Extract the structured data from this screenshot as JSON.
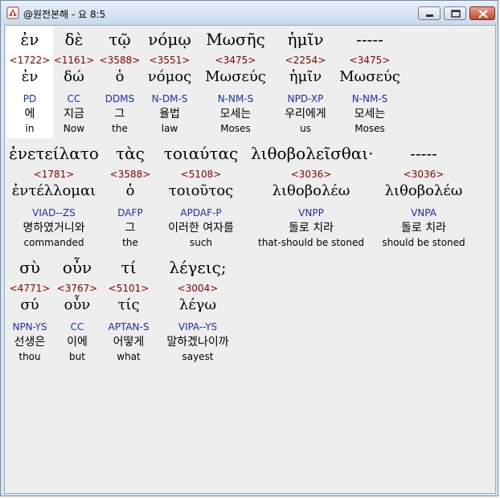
{
  "window": {
    "title": "@원전본해 - 요 8:5",
    "icon": "bible-app-icon",
    "controls": [
      "minimize-icon",
      "maximize-icon",
      "close-icon"
    ],
    "colors": {
      "strong": "#8b0000",
      "parsing": "#1f2fb5",
      "text": "#000000",
      "background": "#eeeeee",
      "highlight": "#ffffff"
    }
  },
  "rows": [
    {
      "words": [
        {
          "greek": "ἐν",
          "strong": "<1722>",
          "lemma": "ἐν",
          "parsing": "PD",
          "korean": "에",
          "english": "in"
        },
        {
          "greek": "δὲ",
          "strong": "<1161>",
          "lemma": "δώ",
          "parsing": "CC",
          "korean": "지금",
          "english": "Now"
        },
        {
          "greek": "τῷ",
          "strong": "<3588>",
          "lemma": "ὁ",
          "parsing": "DDMS",
          "korean": "그",
          "english": "the"
        },
        {
          "greek": "νόμῳ",
          "strong": "<3551>",
          "lemma": "νόμος",
          "parsing": "N-DM-S",
          "korean": "율법",
          "english": "law"
        },
        {
          "greek": "Μωσῆς",
          "strong": "<3475>",
          "lemma": "Μωσεύς",
          "parsing": "N-NM-S",
          "korean": "모세는",
          "english": "Moses"
        },
        {
          "greek": "ἡμῖν",
          "strong": "<2254>",
          "lemma": "ἡμῖν",
          "parsing": "NPD-XP",
          "korean": "우리에게",
          "english": "us"
        },
        {
          "greek": "-----",
          "strong": "<3475>",
          "lemma": "Μωσεύς",
          "parsing": "N-NM-S",
          "korean": "모세는",
          "english": "Moses"
        }
      ]
    },
    {
      "words": [
        {
          "greek": "ἐνετείλατο",
          "strong": "<1781>",
          "lemma": "ἐντέλλομαι",
          "parsing": "VIAD--ZS",
          "korean": "명하였거니와",
          "english": "commanded"
        },
        {
          "greek": "τὰς",
          "strong": "<3588>",
          "lemma": "ὁ",
          "parsing": "DAFP",
          "korean": "그",
          "english": "the"
        },
        {
          "greek": "τοιαύτας",
          "strong": "<5108>",
          "lemma": "τοιοῦτος",
          "parsing": "APDAF-P",
          "korean": "이러한 여자를",
          "english": "such"
        },
        {
          "greek": "λιθοβολεῖσθαι·",
          "strong": "<3036>",
          "lemma": "λιθοβολέω",
          "parsing": "VNPP",
          "korean": "돌로 치라",
          "english": "that-should be stoned"
        },
        {
          "greek": "-----",
          "strong": "<3036>",
          "lemma": "λιθοβολέω",
          "parsing": "VNPA",
          "korean": "돌로 치라",
          "english": "should be stoned"
        }
      ]
    },
    {
      "words": [
        {
          "greek": "σὺ",
          "strong": "<4771>",
          "lemma": "σύ",
          "parsing": "NPN-YS",
          "korean": "선생은",
          "english": "thou"
        },
        {
          "greek": "οὖν",
          "strong": "<3767>",
          "lemma": "οὖν",
          "parsing": "CC",
          "korean": "이에",
          "english": "but"
        },
        {
          "greek": "τί",
          "strong": "<5101>",
          "lemma": "τίς",
          "parsing": "APTAN-S",
          "korean": "어떻게",
          "english": "what"
        },
        {
          "greek": "λέγεις;",
          "strong": "<3004>",
          "lemma": "λέγω",
          "parsing": "VIPA--YS",
          "korean": "말하겠나이까",
          "english": "sayest"
        }
      ]
    }
  ]
}
